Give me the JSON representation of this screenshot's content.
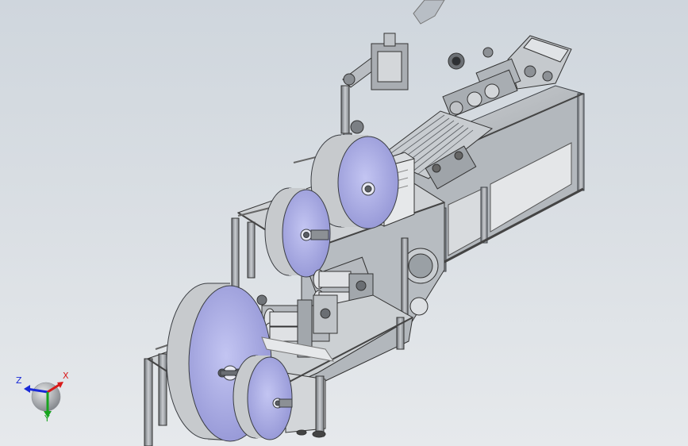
{
  "viewport": {
    "background_top": "#cfd6dd",
    "background_bottom": "#e6e9ec",
    "frame_color": "#8c9094",
    "roll_color": "#aeb0e8",
    "roll_edge_color": "#c9cbd0"
  },
  "triad": {
    "x_label": "X",
    "y_label": "Y",
    "z_label": "Z",
    "x_color": "#d81a1a",
    "y_color": "#17a41f",
    "z_color": "#1a2ad8"
  }
}
